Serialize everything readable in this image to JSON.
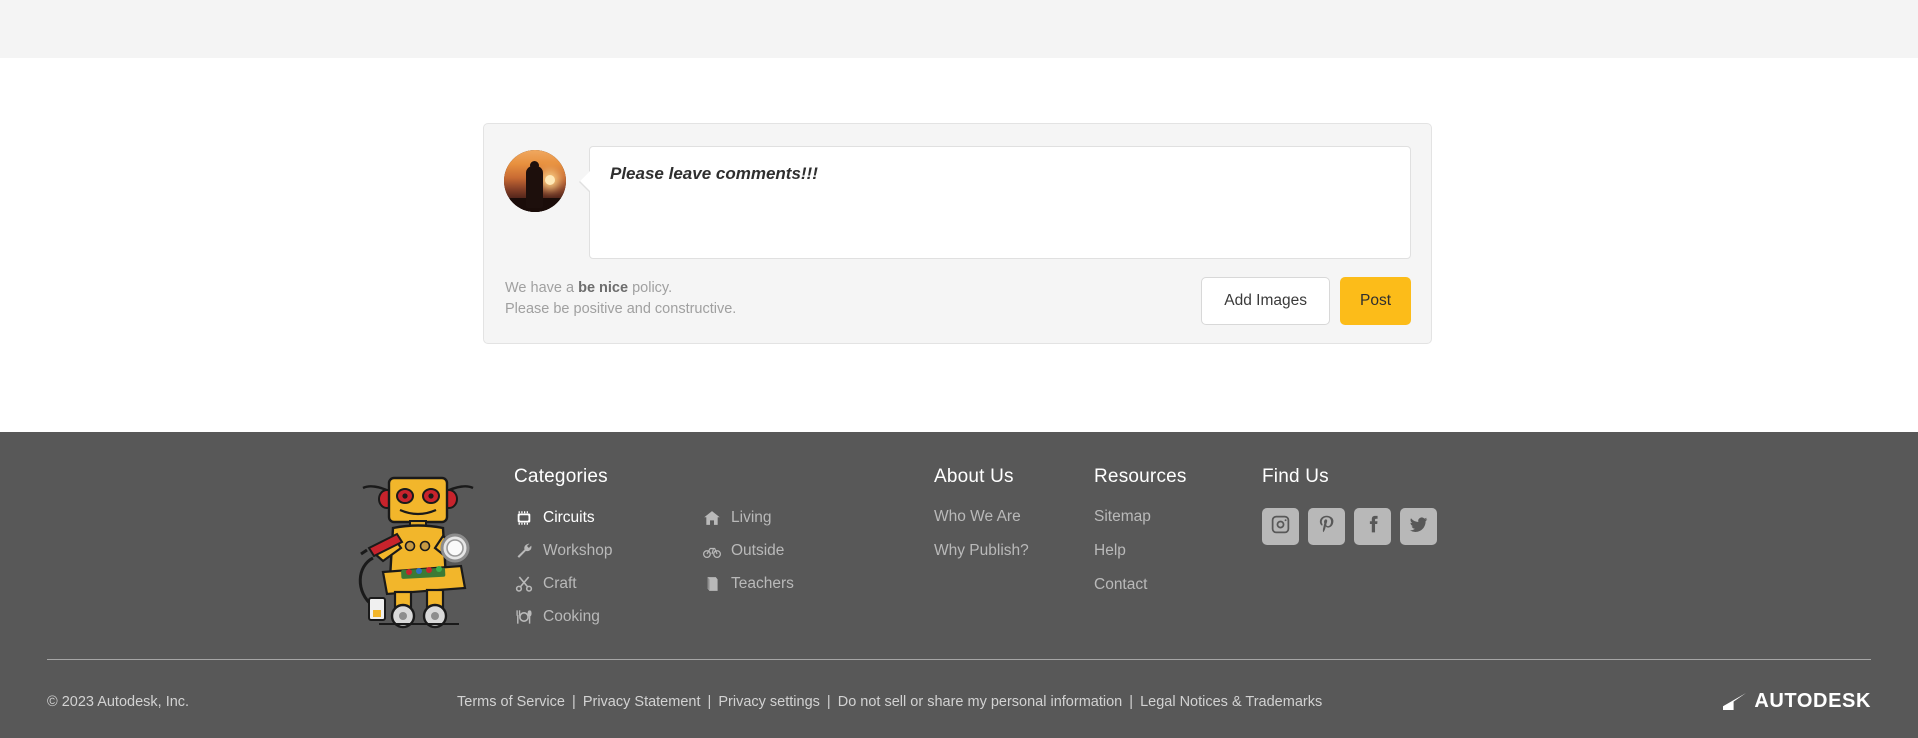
{
  "comment_form": {
    "avatar_name": "user-avatar",
    "comment_text": "Please leave comments!!!",
    "policy_prefix": "We have a ",
    "policy_strong": "be nice",
    "policy_suffix": " policy.",
    "policy_line2": "Please be positive and constructive.",
    "add_images_label": "Add Images",
    "post_label": "Post",
    "post_color": "#fcbc19"
  },
  "footer": {
    "categories": {
      "title": "Categories",
      "column1": [
        {
          "label": "Circuits",
          "icon": "chip-icon",
          "active": true
        },
        {
          "label": "Workshop",
          "icon": "wrench-icon",
          "active": false
        },
        {
          "label": "Craft",
          "icon": "scissors-icon",
          "active": false
        },
        {
          "label": "Cooking",
          "icon": "utensils-icon",
          "active": false
        }
      ],
      "column2": [
        {
          "label": "Living",
          "icon": "house-icon",
          "active": false
        },
        {
          "label": "Outside",
          "icon": "bicycle-icon",
          "active": false
        },
        {
          "label": "Teachers",
          "icon": "book-icon",
          "active": false
        }
      ]
    },
    "about": {
      "title": "About Us",
      "links": [
        "Who We Are",
        "Why Publish?"
      ]
    },
    "resources": {
      "title": "Resources",
      "links": [
        "Sitemap",
        "Help",
        "Contact"
      ]
    },
    "find_us": {
      "title": "Find Us",
      "socials": [
        "instagram-icon",
        "pinterest-icon",
        "facebook-icon",
        "twitter-icon"
      ]
    },
    "legal": {
      "copyright": "© 2023 Autodesk, Inc.",
      "links": [
        "Terms of Service",
        "Privacy Statement",
        "Privacy settings",
        "Do not sell or share my personal information",
        "Legal Notices & Trademarks"
      ],
      "separator": "|",
      "brand": "AUTODESK"
    }
  }
}
